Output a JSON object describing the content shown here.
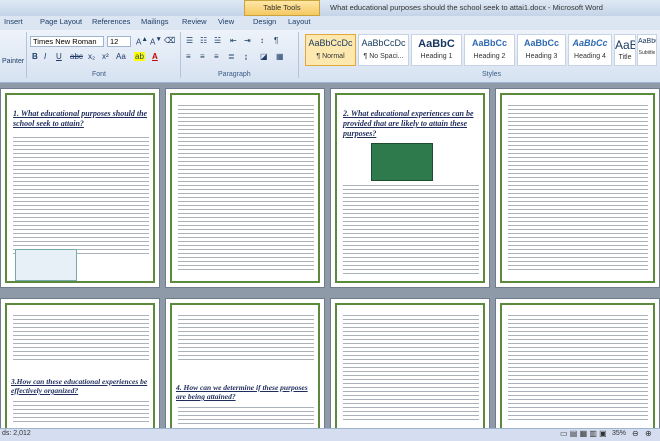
{
  "titlebar": {
    "text": "What educational purposes should the school seek to attai1.docx - Microsoft Word",
    "table_tools": "Table Tools"
  },
  "tabs": [
    "Insert",
    "Page Layout",
    "References",
    "Mailings",
    "Review",
    "View",
    "Design",
    "Layout"
  ],
  "ribbon": {
    "painter_label": "Painter",
    "font_name": "Times New Roman",
    "font_size": "12",
    "groups": {
      "font": "Font",
      "paragraph": "Paragraph",
      "styles": "Styles"
    },
    "styles": [
      {
        "preview": "AaBbCcDc",
        "name": "¶ Normal"
      },
      {
        "preview": "AaBbCcDc",
        "name": "¶ No Spaci..."
      },
      {
        "preview": "AaBbC",
        "name": "Heading 1"
      },
      {
        "preview": "AaBbCc",
        "name": "Heading 2"
      },
      {
        "preview": "AaBbCc",
        "name": "Heading 3"
      },
      {
        "preview": "AaBbCc",
        "name": "Heading 4"
      },
      {
        "preview": "AaB",
        "name": "Title"
      },
      {
        "preview": "AaBbCc",
        "name": "Subtitle"
      }
    ],
    "change_styles": "Cha Sty"
  },
  "pages": {
    "p1_heading": "1. What educational purposes should the school seek to attain?",
    "p3_heading": "2. What educational experiences can be provided that are likely to attain these purposes?",
    "p5_heading": "3.How can these educational experiences be effectively organized?",
    "p7_heading": "4. How can we determine if these purposes are being attained?"
  },
  "status": {
    "words": "ds: 2,012",
    "zoom": "35%"
  }
}
